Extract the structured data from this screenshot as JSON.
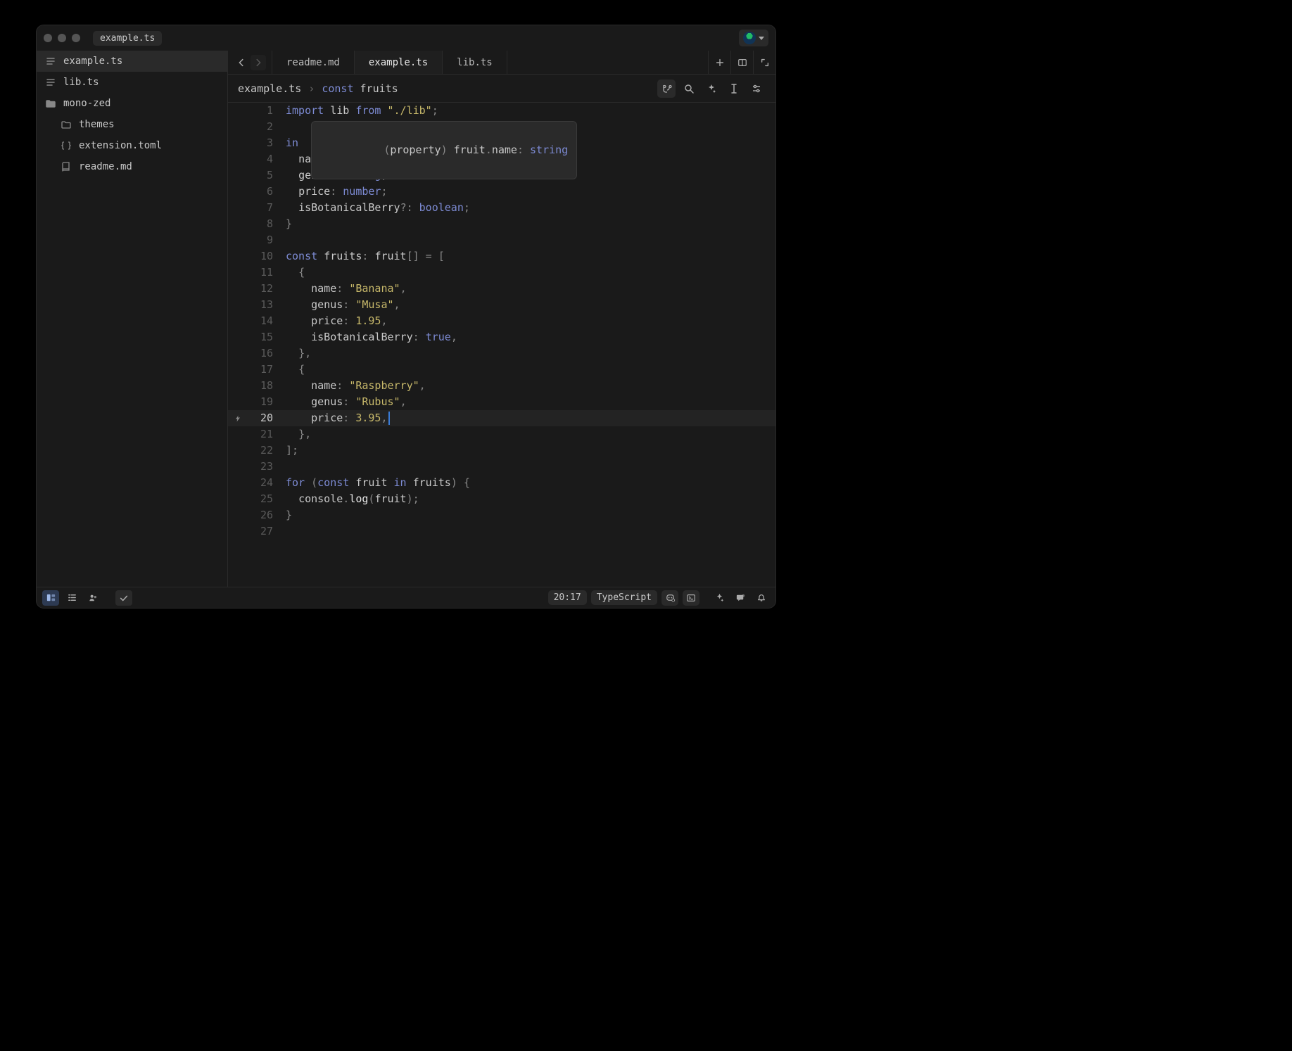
{
  "window": {
    "title": "example.ts"
  },
  "sidebar": {
    "items": [
      {
        "icon": "file",
        "label": "example.ts",
        "active": true,
        "indent": false
      },
      {
        "icon": "file",
        "label": "lib.ts",
        "active": false,
        "indent": false
      },
      {
        "icon": "folder",
        "label": "mono-zed",
        "active": false,
        "indent": false
      },
      {
        "icon": "folder-small",
        "label": "themes",
        "active": false,
        "indent": true
      },
      {
        "icon": "brackets",
        "label": "extension.toml",
        "active": false,
        "indent": true
      },
      {
        "icon": "book",
        "label": "readme.md",
        "active": false,
        "indent": true
      }
    ]
  },
  "tabs": {
    "items": [
      {
        "label": "readme.md",
        "active": false
      },
      {
        "label": "example.ts",
        "active": true
      },
      {
        "label": "lib.ts",
        "active": false
      }
    ]
  },
  "breadcrumb": {
    "file": "example.ts",
    "sep": "›",
    "symbol_kw": "const",
    "symbol_name": "fruits"
  },
  "hover": {
    "text": "(property) fruit.name: string"
  },
  "code": {
    "cursor_line": 20,
    "lines": [
      {
        "n": 1,
        "html": "<span class='tok-kw'>import</span> <span class='tok-ident'>lib</span> <span class='tok-from'>from</span> <span class='tok-str'>\"./lib\"</span><span class='tok-punc'>;</span>"
      },
      {
        "n": 2,
        "html": ""
      },
      {
        "n": 3,
        "html": "<span class='tok-kw'>in</span>"
      },
      {
        "n": 4,
        "html": "  <span class='tok-prop'>name</span><span class='tok-punc'>:</span> <span class='tok-kw'>string</span><span class='tok-punc'>;</span>"
      },
      {
        "n": 5,
        "html": "  <span class='tok-prop'>genus</span><span class='tok-punc'>:</span> <span class='tok-kw'>string</span><span class='tok-punc'>;</span>"
      },
      {
        "n": 6,
        "html": "  <span class='tok-prop'>price</span><span class='tok-punc'>:</span> <span class='tok-kw'>number</span><span class='tok-punc'>;</span>"
      },
      {
        "n": 7,
        "html": "  <span class='tok-prop'>isBotanicalBerry</span><span class='tok-punc'>?:</span> <span class='tok-kw'>boolean</span><span class='tok-punc'>;</span>"
      },
      {
        "n": 8,
        "html": "<span class='tok-punc'>}</span>"
      },
      {
        "n": 9,
        "html": ""
      },
      {
        "n": 10,
        "html": "<span class='tok-kw'>const</span> <span class='tok-ident'>fruits</span><span class='tok-punc'>:</span> <span class='tok-type'>fruit</span><span class='tok-punc'>[] = [</span>"
      },
      {
        "n": 11,
        "html": "  <span class='tok-punc'>{</span>"
      },
      {
        "n": 12,
        "html": "    <span class='tok-prop'>name</span><span class='tok-punc'>:</span> <span class='tok-str'>\"Banana\"</span><span class='tok-punc'>,</span>"
      },
      {
        "n": 13,
        "html": "    <span class='tok-prop'>genus</span><span class='tok-punc'>:</span> <span class='tok-str'>\"Musa\"</span><span class='tok-punc'>,</span>"
      },
      {
        "n": 14,
        "html": "    <span class='tok-prop'>price</span><span class='tok-punc'>:</span> <span class='tok-num'>1.95</span><span class='tok-punc'>,</span>"
      },
      {
        "n": 15,
        "html": "    <span class='tok-prop'>isBotanicalBerry</span><span class='tok-punc'>:</span> <span class='tok-bool'>true</span><span class='tok-punc'>,</span>"
      },
      {
        "n": 16,
        "html": "  <span class='tok-punc'>},</span>"
      },
      {
        "n": 17,
        "html": "  <span class='tok-punc'>{</span>"
      },
      {
        "n": 18,
        "html": "    <span class='tok-prop'>name</span><span class='tok-punc'>:</span> <span class='tok-str'>\"Raspberry\"</span><span class='tok-punc'>,</span>"
      },
      {
        "n": 19,
        "html": "    <span class='tok-prop'>genus</span><span class='tok-punc'>:</span> <span class='tok-str'>\"Rubus\"</span><span class='tok-punc'>,</span>"
      },
      {
        "n": 20,
        "html": "    <span class='tok-prop'>price</span><span class='tok-punc'>:</span> <span class='tok-num'>3.95</span><span class='tok-punc'>,</span><span class='cursor'></span>",
        "gutterIcon": "bolt"
      },
      {
        "n": 21,
        "html": "  <span class='tok-punc'>},</span>"
      },
      {
        "n": 22,
        "html": "<span class='tok-punc'>];</span>"
      },
      {
        "n": 23,
        "html": ""
      },
      {
        "n": 24,
        "html": "<span class='tok-kw'>for</span> <span class='tok-punc'>(</span><span class='tok-kw'>const</span> <span class='tok-ident'>fruit</span> <span class='tok-kw'>in</span> <span class='tok-ident'>fruits</span><span class='tok-punc'>) {</span>"
      },
      {
        "n": 25,
        "html": "  <span class='tok-ident'>console</span><span class='tok-punc'>.</span><span class='tok-func'>log</span><span class='tok-punc'>(</span><span class='tok-ident'>fruit</span><span class='tok-punc'>);</span>"
      },
      {
        "n": 26,
        "html": "<span class='tok-punc'>}</span>"
      },
      {
        "n": 27,
        "html": ""
      }
    ]
  },
  "status": {
    "position": "20:17",
    "language": "TypeScript"
  }
}
